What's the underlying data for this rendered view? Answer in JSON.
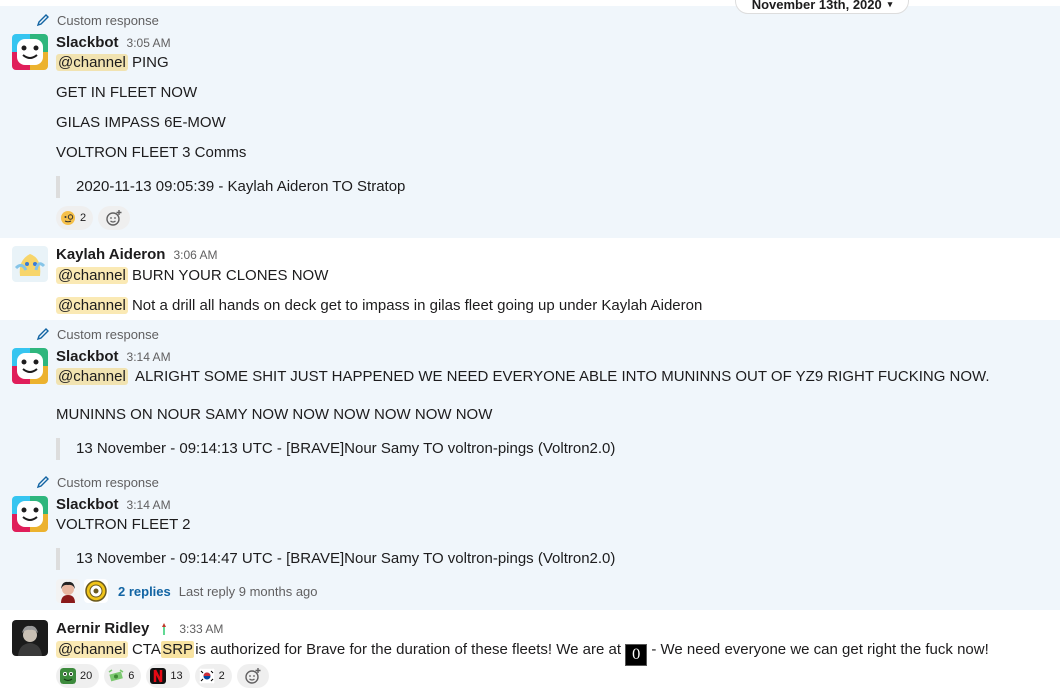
{
  "date_divider": {
    "label": "November 13th, 2020"
  },
  "messages": [
    {
      "custom_response": "Custom response",
      "author": "Slackbot",
      "time": "3:05 AM",
      "lines": [
        "@channel",
        "PING",
        "GET IN FLEET NOW",
        "GILAS IMPASS 6E-MOW",
        "VOLTRON FLEET 3 Comms"
      ],
      "quote": "2020-11-13 09:05:39 - Kaylah Aideron TO Stratop",
      "reactions": [
        {
          "emoji": "face-with-monocle",
          "count": "2"
        }
      ]
    },
    {
      "author": "Kaylah Aideron",
      "time": "3:06 AM",
      "mention": "@channel",
      "line1": "BURN YOUR CLONES NOW",
      "line2": "Not a drill all hands on deck get to impass in gilas fleet going up under Kaylah Aideron"
    },
    {
      "custom_response": "Custom response",
      "author": "Slackbot",
      "time": "3:14 AM",
      "mention": "@channel",
      "line1": "ALRIGHT SOME SHIT JUST HAPPENED WE NEED EVERYONE ABLE INTO MUNINNS OUT OF YZ9 RIGHT FUCKING NOW.",
      "line2": "MUNINNS ON NOUR SAMY NOW NOW NOW NOW NOW NOW",
      "quote": "13 November - 09:14:13 UTC - [BRAVE]Nour Samy TO voltron-pings (Voltron2.0)"
    },
    {
      "custom_response": "Custom response",
      "author": "Slackbot",
      "time": "3:14 AM",
      "line1": "VOLTRON FLEET 2",
      "quote": "13 November - 09:14:47 UTC - [BRAVE]Nour Samy TO voltron-pings (Voltron2.0)",
      "thread": {
        "replies": "2 replies",
        "last_reply": "Last reply 9 months ago"
      }
    },
    {
      "author": "Aernir Ridley",
      "time": "3:33 AM",
      "mention": "@channel",
      "text_a": "CTA",
      "text_srp": "SRP",
      "text_b": "is authorized for Brave for the duration of these fleets! We are at",
      "inline_image_glyph": "0",
      "text_c": "- We need everyone we can get right the fuck now!",
      "reactions": [
        {
          "emoji": "green-frog",
          "count": "20"
        },
        {
          "emoji": "money-flying",
          "count": "6"
        },
        {
          "emoji": "netflix-n",
          "count": "13"
        },
        {
          "emoji": "south-korea-flag",
          "count": "2"
        }
      ]
    }
  ]
}
